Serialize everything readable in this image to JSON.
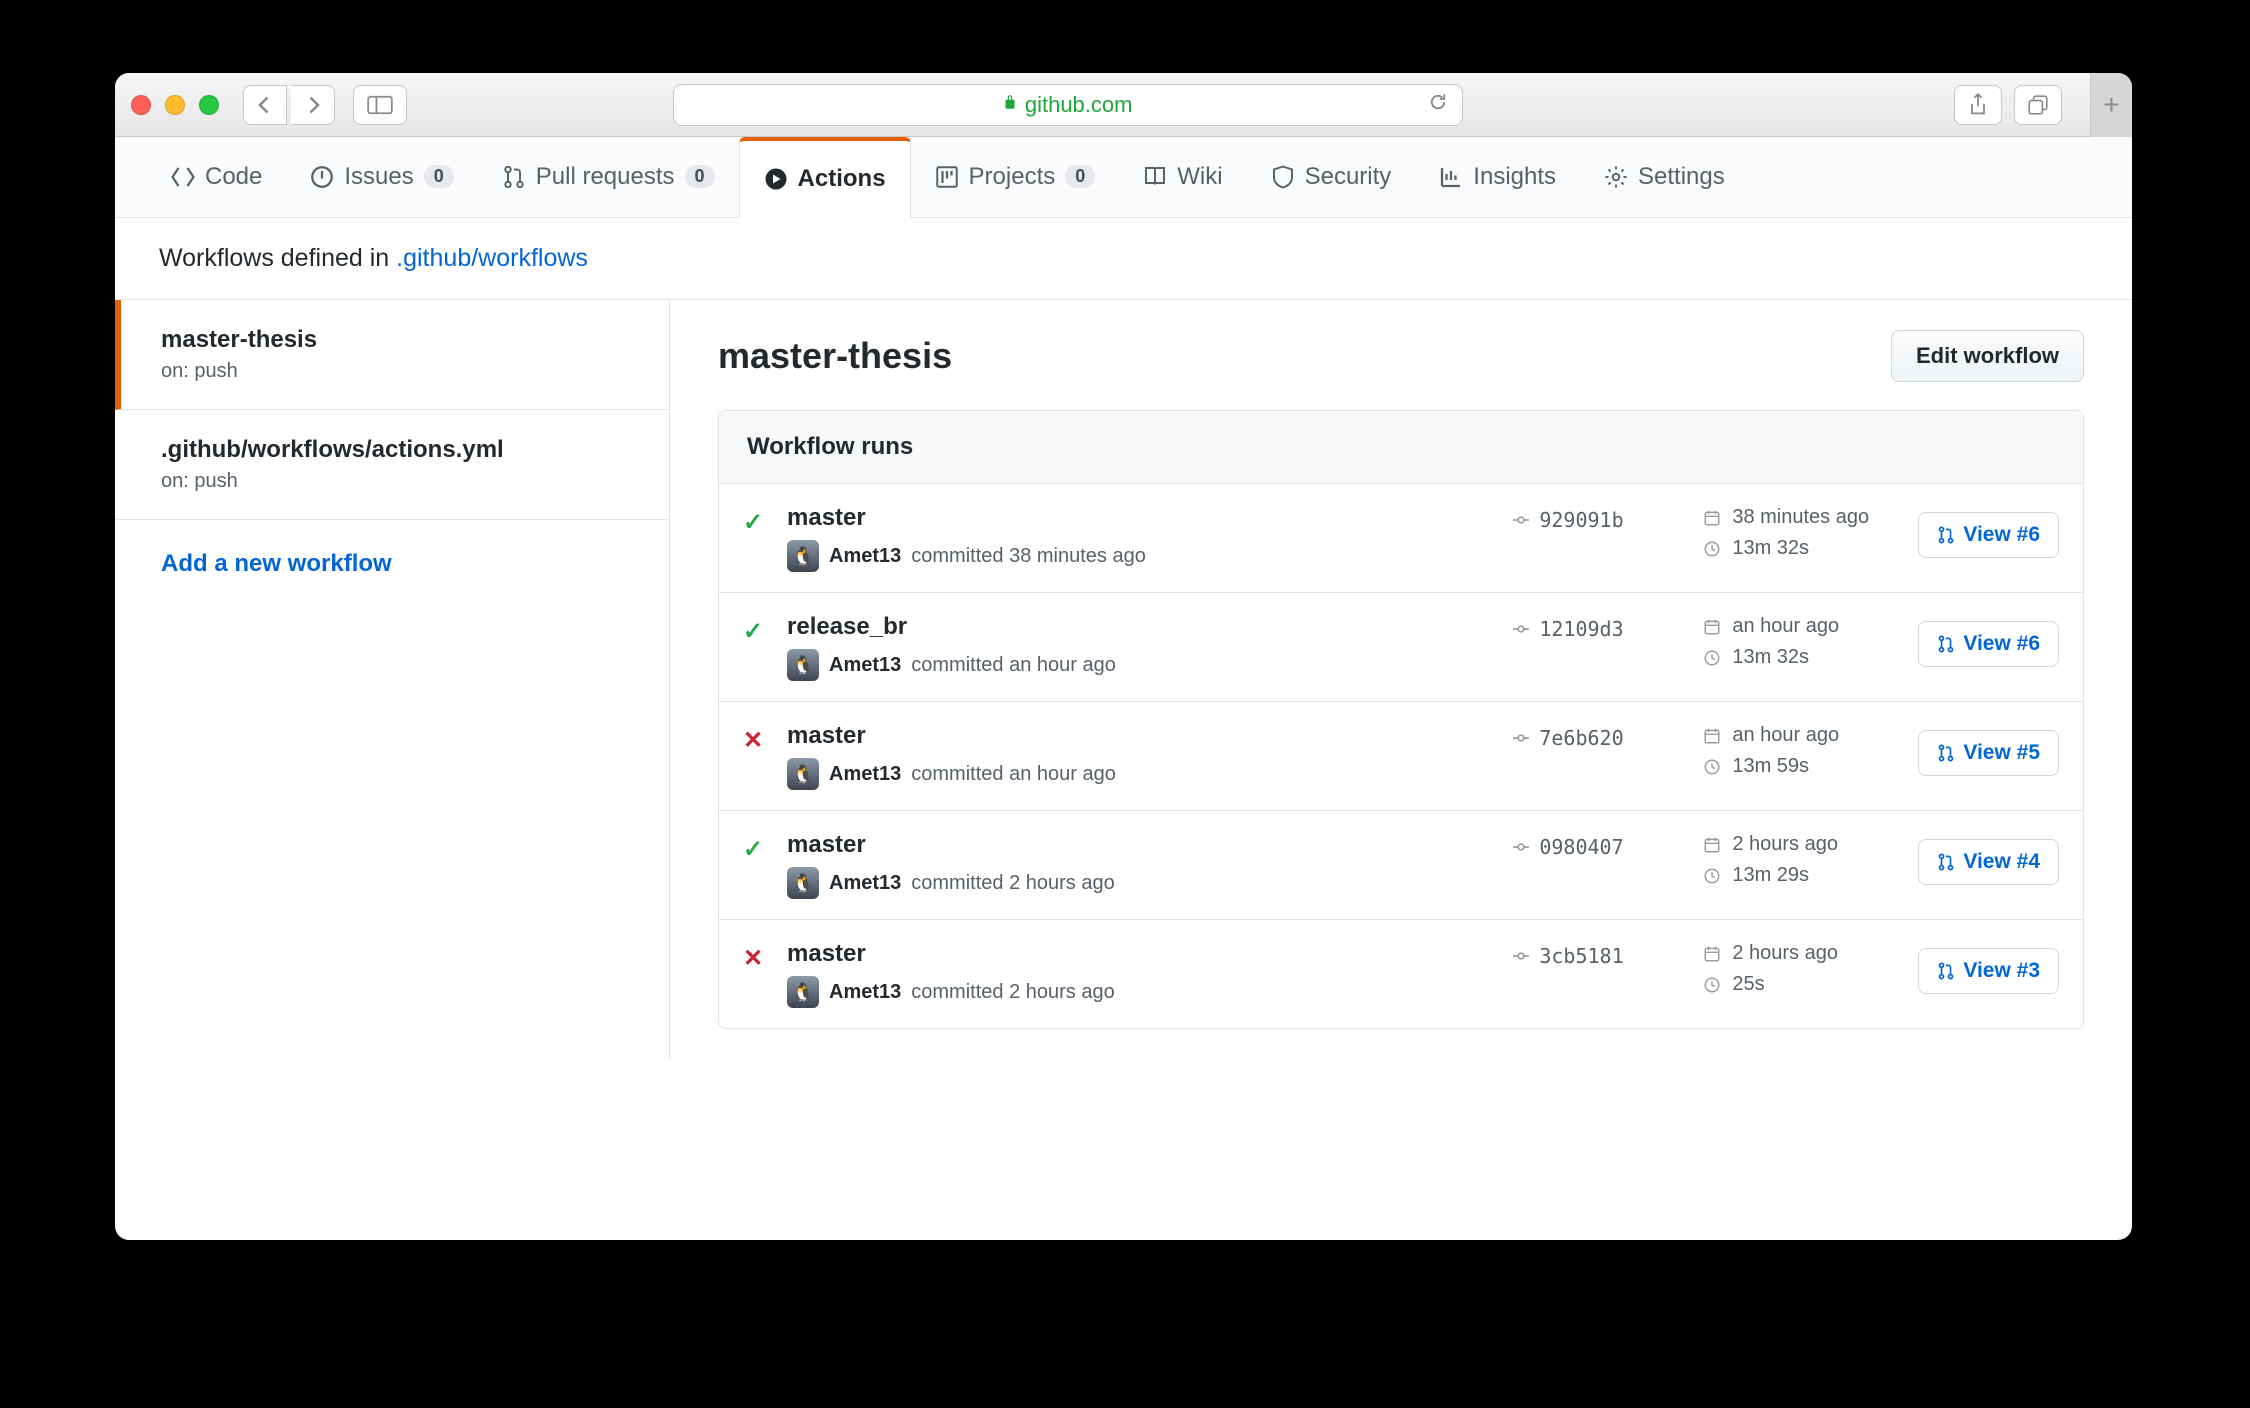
{
  "browser": {
    "domain": "github.com"
  },
  "repo_tabs": {
    "code": "Code",
    "issues": "Issues",
    "issues_count": "0",
    "pulls": "Pull requests",
    "pulls_count": "0",
    "actions": "Actions",
    "projects": "Projects",
    "projects_count": "0",
    "wiki": "Wiki",
    "security": "Security",
    "insights": "Insights",
    "settings": "Settings"
  },
  "def_line": {
    "prefix": "Workflows defined in ",
    "path": ".github/workflows"
  },
  "sidebar": {
    "items": [
      {
        "title": "master-thesis",
        "sub": "on: push",
        "active": true
      },
      {
        "title": ".github/workflows/actions.yml",
        "sub": "on: push",
        "active": false
      }
    ],
    "add": "Add a new workflow"
  },
  "main": {
    "title": "master-thesis",
    "edit": "Edit workflow",
    "runs_header": "Workflow runs"
  },
  "runs": [
    {
      "status": "ok",
      "branch": "master",
      "author": "Amet13",
      "when": "committed 38 minutes ago",
      "sha": "929091b",
      "ago": "38 minutes ago",
      "dur": "13m 32s",
      "view": "View #6"
    },
    {
      "status": "ok",
      "branch": "release_br",
      "author": "Amet13",
      "when": "committed an hour ago",
      "sha": "12109d3",
      "ago": "an hour ago",
      "dur": "13m 32s",
      "view": "View #6"
    },
    {
      "status": "fail",
      "branch": "master",
      "author": "Amet13",
      "when": "committed an hour ago",
      "sha": "7e6b620",
      "ago": "an hour ago",
      "dur": "13m 59s",
      "view": "View #5"
    },
    {
      "status": "ok",
      "branch": "master",
      "author": "Amet13",
      "when": "committed 2 hours ago",
      "sha": "0980407",
      "ago": "2 hours ago",
      "dur": "13m 29s",
      "view": "View #4"
    },
    {
      "status": "fail",
      "branch": "master",
      "author": "Amet13",
      "when": "committed 2 hours ago",
      "sha": "3cb5181",
      "ago": "2 hours ago",
      "dur": "25s",
      "view": "View #3"
    }
  ]
}
